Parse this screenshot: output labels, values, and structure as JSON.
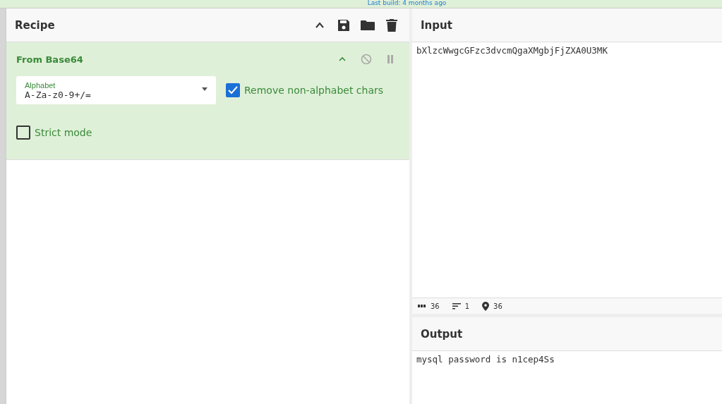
{
  "banner": {
    "text": "Last build: 4 months ago"
  },
  "recipe": {
    "title": "Recipe",
    "operations": [
      {
        "name": "From Base64",
        "disabled": false,
        "breakpoint": false,
        "args": [
          {
            "kind": "select",
            "label": "Alphabet",
            "value": "A-Za-z0-9+/="
          },
          {
            "kind": "checkbox",
            "label": "Remove non-alphabet chars",
            "checked": true
          },
          {
            "kind": "checkbox",
            "label": "Strict mode",
            "checked": false
          }
        ]
      }
    ]
  },
  "input": {
    "title": "Input",
    "value": "bXlzcWwgcGFzc3dvcmQgaXMgbjFjZXA0U3MK",
    "status": [
      {
        "kind": "length",
        "value": "36"
      },
      {
        "kind": "lines",
        "value": "1"
      },
      {
        "kind": "position",
        "value": "36"
      }
    ]
  },
  "output": {
    "title": "Output",
    "value": "mysql password is n1cep4Ss"
  }
}
